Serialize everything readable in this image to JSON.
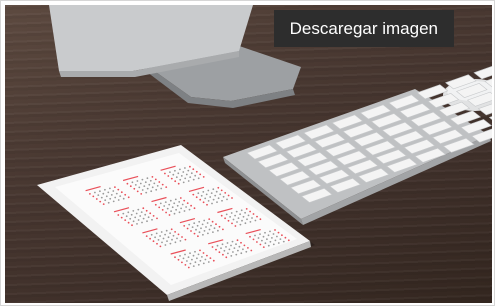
{
  "download_button": {
    "label": "Descaregar imagen"
  },
  "photo": {
    "subject": "monitor-keyboard-tablet-calendar-photo"
  },
  "colors": {
    "button_bg": "#2d2d2d",
    "button_text": "#ffffff",
    "desk": "#4a3932",
    "calendar_accent": "#e9505a"
  }
}
